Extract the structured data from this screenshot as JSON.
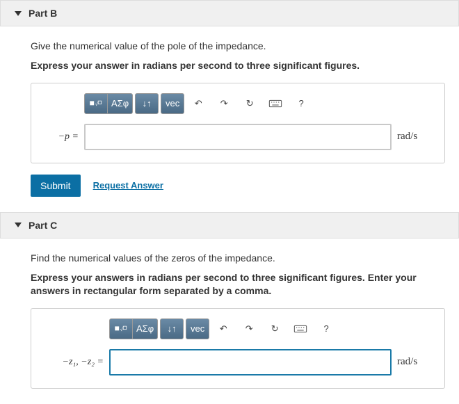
{
  "parts": [
    {
      "key": "b",
      "title": "Part B",
      "prompt": "Give the numerical value of the pole of the impedance.",
      "instruction": "Express your answer in radians per second to three significant figures.",
      "lhs": "−p =",
      "unit": "rad/s",
      "input_value": "",
      "focused": false,
      "lhs_wide": false
    },
    {
      "key": "c",
      "title": "Part C",
      "prompt": "Find the numerical values of the zeros of the impedance.",
      "instruction": "Express your answers in radians per second to three significant figures. Enter your answers in rectangular form separated by a comma.",
      "lhs": "−z₁, −z₂ =",
      "unit": "rad/s",
      "input_value": "",
      "focused": true,
      "lhs_wide": true
    }
  ],
  "toolbar": {
    "template": "▫√▫",
    "greek": "ΑΣφ",
    "subsup": "↓↑",
    "vec_label": "vec",
    "undo": "↶",
    "redo": "↷",
    "reset": "↻",
    "help": "?"
  },
  "actions": {
    "submit": "Submit",
    "request": "Request Answer"
  }
}
